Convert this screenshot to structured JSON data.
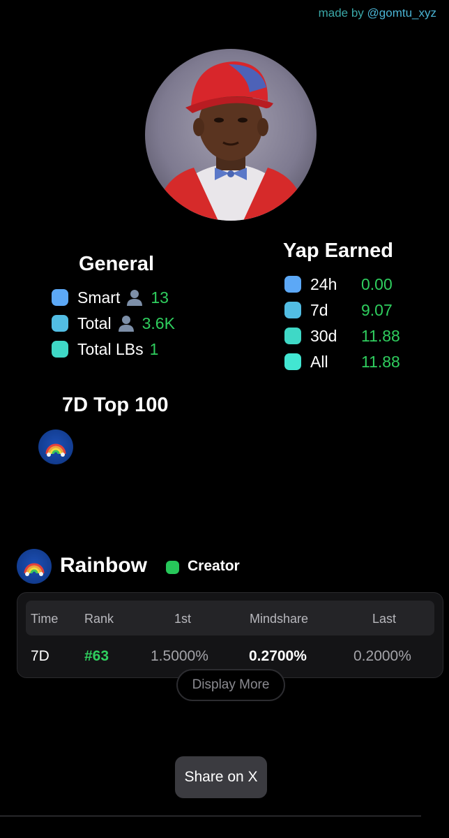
{
  "header": {
    "made_by_prefix": "made by ",
    "made_by_handle": "@gomtu_xyz"
  },
  "profile": {
    "avatar_description": "portrait-photo"
  },
  "general": {
    "title": "General",
    "smart_label": "Smart",
    "smart_value": "13",
    "total_label": "Total",
    "total_value": "3.6K",
    "lbs_label": "Total LBs",
    "lbs_value": "1"
  },
  "yap": {
    "title": "Yap Earned",
    "rows": [
      {
        "period": "24h",
        "value": "0.00"
      },
      {
        "period": "7d",
        "value": "9.07"
      },
      {
        "period": "30d",
        "value": "11.88"
      },
      {
        "period": "All",
        "value": "11.88"
      }
    ]
  },
  "top100": {
    "title": "7D Top 100",
    "badge_icon": "rainbow-icon"
  },
  "project": {
    "name": "Rainbow",
    "tag": "Creator",
    "table": {
      "headers": [
        "Time",
        "Rank",
        "1st",
        "Mindshare",
        "Last"
      ],
      "rows": [
        {
          "time": "7D",
          "rank": "#63",
          "first": "1.5000%",
          "mindshare": "0.2700%",
          "last": "0.2000%"
        }
      ]
    },
    "display_more_label": "Display More"
  },
  "actions": {
    "share_label": "Share on X"
  },
  "colors": {
    "background": "#000000",
    "value_green": "#2fce5e",
    "creator_green": "#27c75a",
    "dot_blue": "#5ca8f6",
    "dot_sky": "#52bde3",
    "dot_teal": "#3fd8c6",
    "dot_aqua": "#42e6d2",
    "handle_teal": "#3aa7a7"
  }
}
